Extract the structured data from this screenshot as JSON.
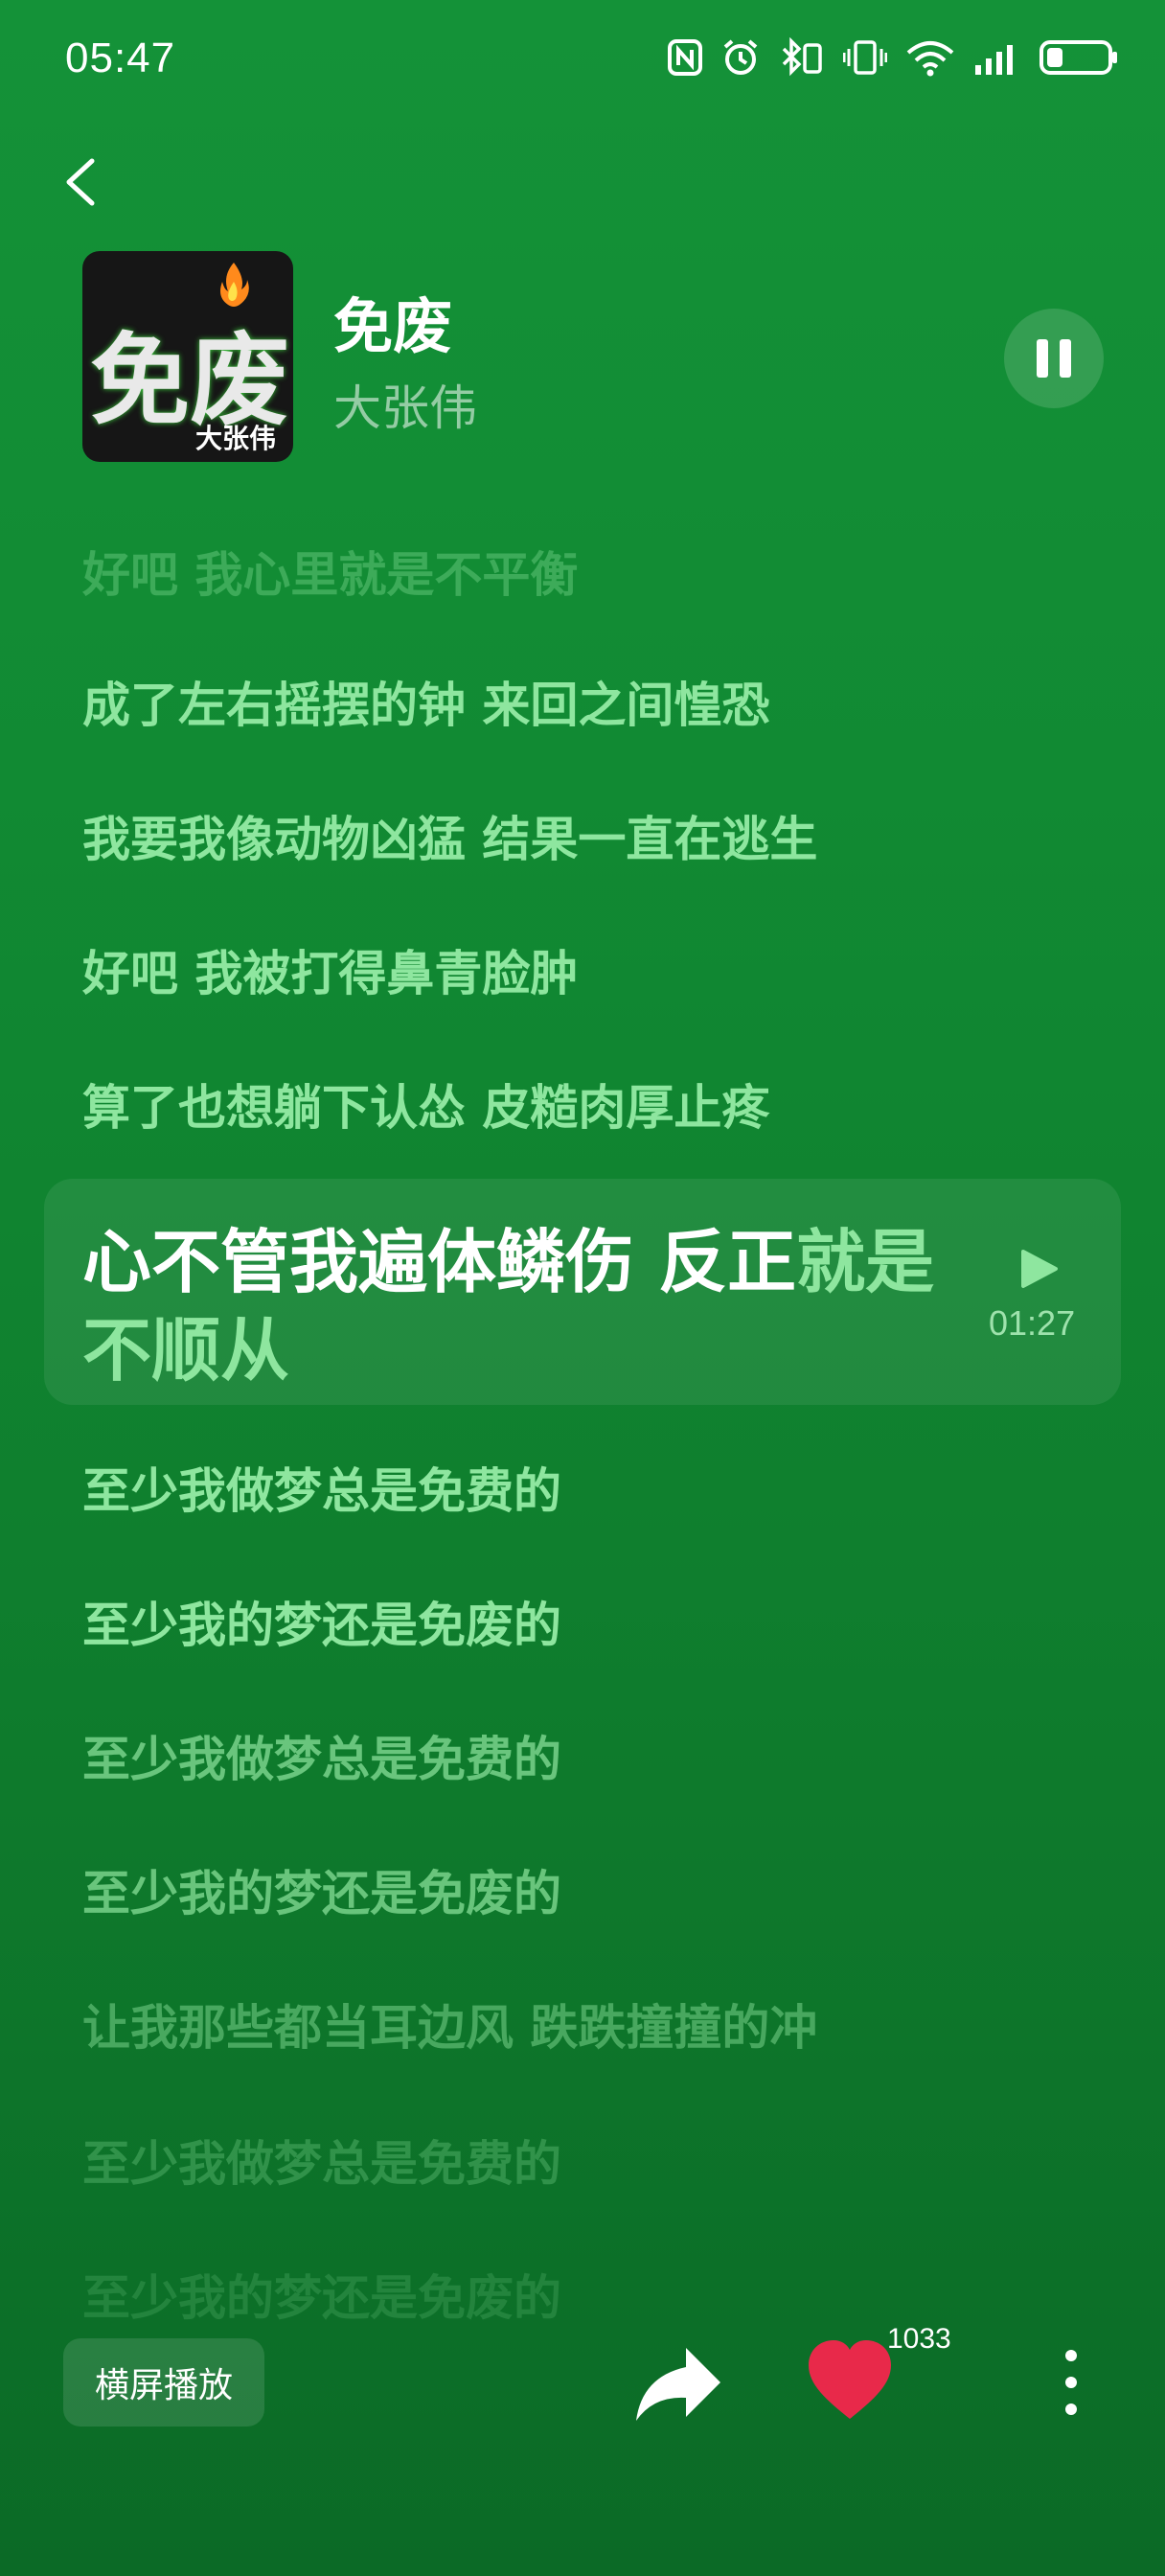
{
  "status_bar": {
    "time": "05:47",
    "icons": [
      "nfc-icon",
      "alarm-icon",
      "bluetooth-icon",
      "vibrate-icon",
      "wifi-icon",
      "signal-icon",
      "battery-icon"
    ]
  },
  "header": {
    "back_icon": "chevron-left-icon",
    "cover_text": "免废",
    "cover_artist": "大张伟",
    "title": "免废",
    "artist": "大张伟",
    "control_icon": "pause-icon"
  },
  "lyrics": {
    "before": [
      "好吧 我心里就是不平衡",
      "成了左右摇摆的钟 来回之间惶恐",
      "我要我像动物凶猛 结果一直在逃生",
      "好吧 我被打得鼻青脸肿",
      "算了也想躺下认怂 皮糙肉厚止疼"
    ],
    "active": {
      "line1_lit": "心不管我遍体鳞伤 反正",
      "line1_unlit": "就是",
      "line2_unlit": "不顺从",
      "time": "01:27",
      "icon": "play-triangle-icon"
    },
    "after": [
      "至少我做梦总是免费的",
      "至少我的梦还是免废的",
      "至少我做梦总是免费的",
      "至少我的梦还是免废的",
      "让我那些都当耳边风 跌跌撞撞的冲",
      "至少我做梦总是免费的",
      "至少我的梦还是免废的"
    ]
  },
  "bottom": {
    "landscape_label": "横屏播放",
    "share_icon": "share-icon",
    "like_icon": "heart-icon",
    "like_count": "1033",
    "more_icon": "more-vertical-icon",
    "heart_color": "#e8294a"
  }
}
